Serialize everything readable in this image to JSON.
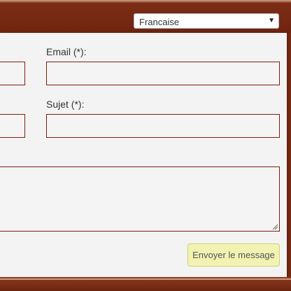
{
  "header": {
    "language_select": {
      "value": "Francaise"
    }
  },
  "form": {
    "email_label": "Email (*):",
    "subject_label": "Sujet (*):",
    "send_button": "Envoyer le message"
  },
  "colors": {
    "header_bg": "#7a2a14",
    "field_border": "#7a1f0f",
    "panel_bg": "#f3f3f3",
    "button_bg": "#f2f3b2"
  }
}
